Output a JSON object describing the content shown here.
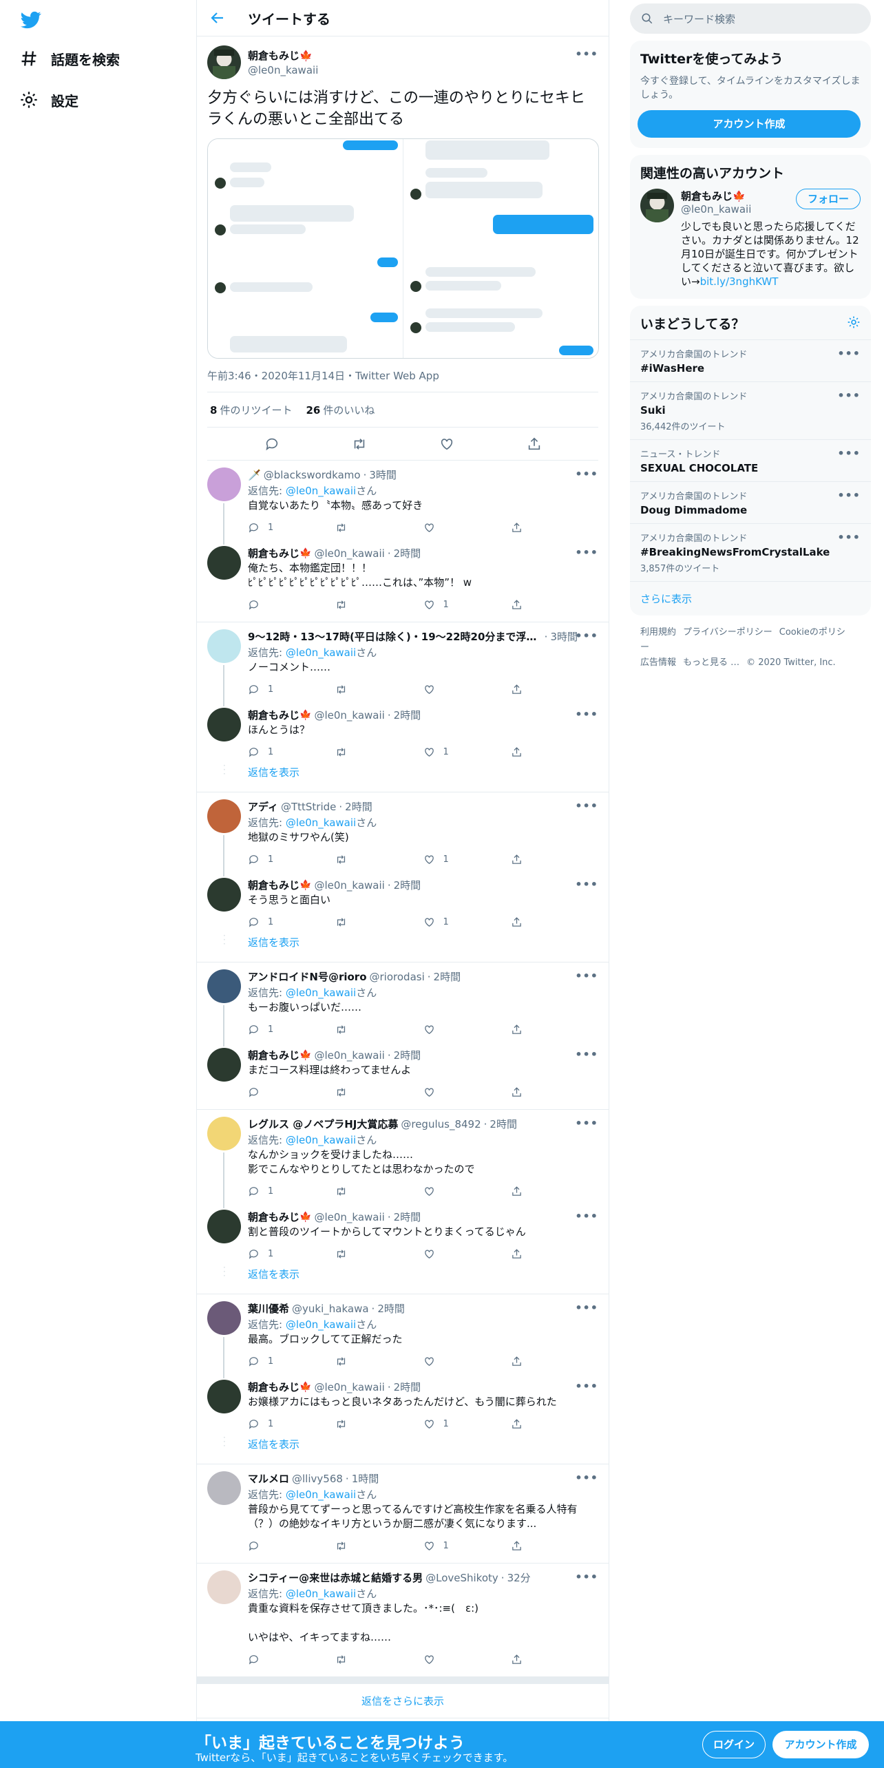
{
  "nav": {
    "explore": "話題を検索",
    "settings": "設定"
  },
  "header": {
    "title": "ツイートする"
  },
  "main_tweet": {
    "name": "朝倉もみじ🍁",
    "handle": "@le0n_kawaii",
    "text": "夕方ぐらいには消すけど、この一連のやりとりにセキヒラくんの悪いとこ全部出てる",
    "time": "午前3:46・2020年11月14日・Twitter Web App",
    "retweets": "8",
    "retweets_label": "件のリツイート",
    "likes": "26",
    "likes_label": "件のいいね"
  },
  "replying_label": "返信先:",
  "replying_suffix": "さん",
  "replying_to": "@le0n_kawaii",
  "show_replies": "返信を表示",
  "more_replies": "返信をさらに表示",
  "threads": [
    {
      "replies": [
        {
          "name": "🗡️",
          "handle": "@blackswordkamo",
          "time": "3時間",
          "reply": true,
          "text": "自覚ないあたり〝本物〟感あって好き",
          "counts": [
            "1",
            "",
            "",
            ""
          ],
          "avatar": "#c9a0d9"
        },
        {
          "name": "朝倉もみじ",
          "leaf": true,
          "handle": "@le0n_kawaii",
          "time": "2時間",
          "reply": false,
          "text": "俺たち、本物鑑定団！！！\nﾋﾟﾋﾟﾋﾟﾋﾟﾋﾟﾋﾟﾋﾟﾋﾟﾋﾟﾋﾟﾋﾟ……これは、”本物”！ w",
          "counts": [
            "",
            "",
            "1",
            ""
          ],
          "avatar": "#2b3a2f"
        }
      ],
      "show": false
    },
    {
      "replies": [
        {
          "name": "9～12時・13～17時(平日は除く)・19～22時20分まで浮上し…",
          "handle": "",
          "time": "3時間",
          "reply": true,
          "text": "ノーコメント……",
          "counts": [
            "1",
            "",
            "",
            ""
          ],
          "avatar": "#bfe6ee"
        },
        {
          "name": "朝倉もみじ",
          "leaf": true,
          "handle": "@le0n_kawaii",
          "time": "2時間",
          "reply": false,
          "text": "ほんとうは？",
          "counts": [
            "1",
            "",
            "1",
            ""
          ],
          "avatar": "#2b3a2f"
        }
      ],
      "show": true
    },
    {
      "replies": [
        {
          "name": "アディ",
          "handle": "@TttStride",
          "time": "2時間",
          "reply": true,
          "text": "地獄のミサワやん(笑)",
          "counts": [
            "1",
            "",
            "1",
            ""
          ],
          "avatar": "#c0643a"
        },
        {
          "name": "朝倉もみじ",
          "leaf": true,
          "handle": "@le0n_kawaii",
          "time": "2時間",
          "reply": false,
          "text": "そう思うと面白い",
          "counts": [
            "1",
            "",
            "1",
            ""
          ],
          "avatar": "#2b3a2f"
        }
      ],
      "show": true
    },
    {
      "replies": [
        {
          "name": "アンドロイドN号@rioro",
          "handle": "@riorodasi",
          "time": "2時間",
          "reply": true,
          "text": "もーお腹いっぱいだ……",
          "counts": [
            "1",
            "",
            "",
            ""
          ],
          "avatar": "#3b5a7a"
        },
        {
          "name": "朝倉もみじ",
          "leaf": true,
          "handle": "@le0n_kawaii",
          "time": "2時間",
          "reply": false,
          "text": "まだコース料理は終わってませんよ",
          "counts": [
            "",
            "",
            "",
            ""
          ],
          "avatar": "#2b3a2f"
        }
      ],
      "show": false
    },
    {
      "replies": [
        {
          "name": "レグルス @ノベプラHJ大賞応募",
          "handle": "@regulus_8492",
          "time": "2時間",
          "reply": true,
          "text": "なんかショックを受けましたね……\n影でこんなやりとりしてたとは思わなかったので",
          "counts": [
            "1",
            "",
            "",
            ""
          ],
          "avatar": "#f2d675"
        },
        {
          "name": "朝倉もみじ",
          "leaf": true,
          "handle": "@le0n_kawaii",
          "time": "2時間",
          "reply": false,
          "text": "割と普段のツイートからしてマウントとりまくってるじゃん",
          "counts": [
            "1",
            "",
            "",
            ""
          ],
          "avatar": "#2b3a2f"
        }
      ],
      "show": true
    },
    {
      "replies": [
        {
          "name": "葉川優希",
          "handle": "@yuki_hakawa",
          "time": "2時間",
          "reply": true,
          "text": "最高。ブロックしてて正解だった",
          "counts": [
            "1",
            "",
            "",
            ""
          ],
          "avatar": "#6b5a78"
        },
        {
          "name": "朝倉もみじ",
          "leaf": true,
          "handle": "@le0n_kawaii",
          "time": "2時間",
          "reply": false,
          "text": "お嬢様アカにはもっと良いネタあったんだけど、もう闇に葬られた",
          "counts": [
            "1",
            "",
            "1",
            ""
          ],
          "avatar": "#2b3a2f"
        }
      ],
      "show": true
    },
    {
      "replies": [
        {
          "name": "マルメロ",
          "handle": "@llivy568",
          "time": "1時間",
          "reply": true,
          "text": "普段から見ててずーっと思ってるんですけど高校生作家を名乗る人特有（？）の絶妙なイキリ方というか厨二感が凄く気になります...",
          "counts": [
            "",
            "",
            "1",
            ""
          ],
          "avatar": "#b9b9c0"
        }
      ],
      "show": false
    },
    {
      "replies": [
        {
          "name": "シコティー@来世は赤城と結婚する男",
          "handle": "@LoveShikoty",
          "time": "32分",
          "reply": true,
          "text": "貴重な資料を保存させて頂きました。･*･:≡(　ε:)\n\nいやはや、イキってますね……",
          "counts": [
            "",
            "",
            "",
            ""
          ],
          "avatar": "#e8d8d0"
        }
      ],
      "show": false
    }
  ],
  "right": {
    "search_placeholder": "キーワード検索",
    "signup_title": "Twitterを使ってみよう",
    "signup_desc": "今すぐ登録して、タイムラインをカスタマイズしましょう。",
    "signup_button": "アカウント作成",
    "related_title": "関連性の高いアカウント",
    "related": {
      "name": "朝倉もみじ🍁",
      "handle": "@le0n_kawaii",
      "follow": "フォロー",
      "bio": "少しでも良いと思ったら応援してください。カナダとは関係ありません。12月10日が誕生日です。何かプレゼントしてくださると泣いて喜びます。欲しい→",
      "bio_link": "bit.ly/3nghKWT"
    },
    "trends_title": "いまどうしてる？",
    "trends": [
      {
        "context": "アメリカ合衆国のトレンド",
        "name": "#iWasHere",
        "count": ""
      },
      {
        "context": "アメリカ合衆国のトレンド",
        "name": "Suki",
        "count": "36,442件のツイート"
      },
      {
        "context": "ニュース・トレンド",
        "name": "SEXUAL CHOCOLATE",
        "count": ""
      },
      {
        "context": "アメリカ合衆国のトレンド",
        "name": "Doug Dimmadome",
        "count": ""
      },
      {
        "context": "アメリカ合衆国のトレンド",
        "name": "#BreakingNewsFromCrystalLake",
        "count": "3,857件のツイート"
      }
    ],
    "trends_more": "さらに表示",
    "footer": [
      "利用規約",
      "プライバシーポリシー",
      "Cookieのポリシー",
      "広告情報",
      "もっと見る …",
      "© 2020 Twitter, Inc."
    ]
  },
  "banner": {
    "title": "「いま」起きていることを見つけよう",
    "subtitle": "Twitterなら、「いま」起きていることをいち早くチェックできます。",
    "login": "ログイン",
    "signup": "アカウント作成"
  }
}
